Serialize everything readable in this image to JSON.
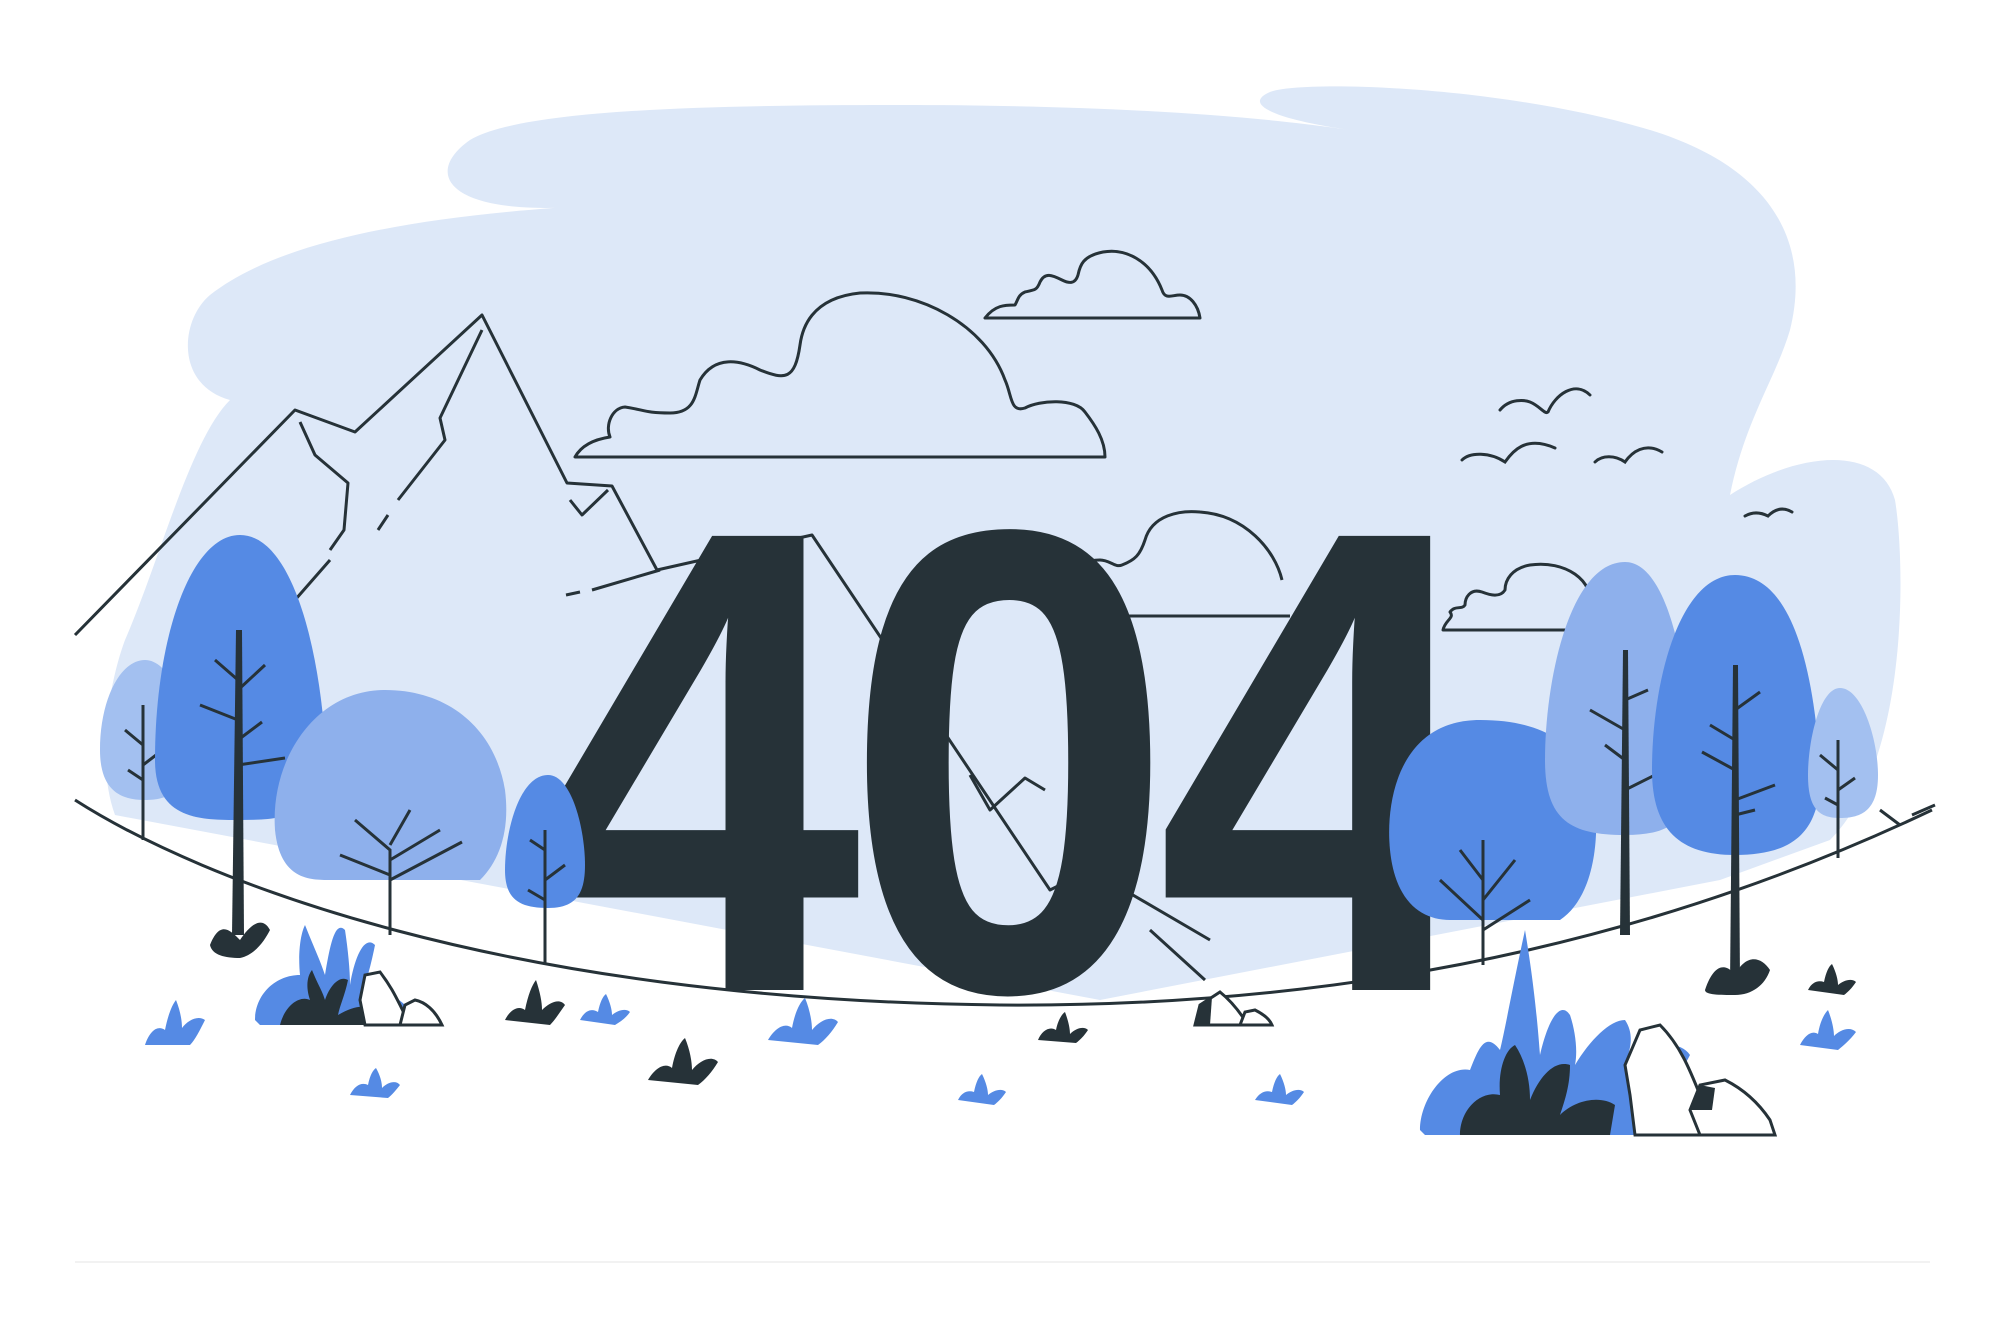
{
  "error_code": "404",
  "colors": {
    "background": "#ffffff",
    "sky": "#dde8f8",
    "blue": "#558ae4",
    "light_blue": "#8eb0ec",
    "lighter_blue": "#a3c0f0",
    "dark": "#263238",
    "line": "#263238"
  },
  "illustration": {
    "elements": [
      "mountain",
      "clouds",
      "birds",
      "trees",
      "bushes",
      "grass",
      "rocks",
      "ground"
    ]
  }
}
